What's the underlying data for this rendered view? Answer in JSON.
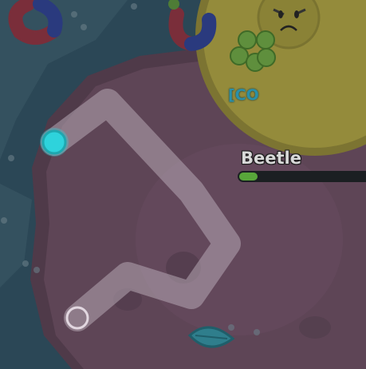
{
  "enemy": {
    "name": "Beetle",
    "health_fraction": 0.14
  },
  "other_player": {
    "clan_tag_visible": "[CO"
  },
  "colors": {
    "ocean": "#2b4756",
    "ocean_shallow": "#3a5866",
    "land": "#5e4556",
    "land_light": "#6b4d61",
    "path": "#b7a7b5",
    "player_cell": "#2ed3dc",
    "hill": "#948b3b",
    "health_bar": "#58a63a"
  },
  "icons": [
    "player-cell-icon",
    "leaf-icon",
    "clover-icon",
    "worm-icon",
    "boss-face-icon"
  ]
}
